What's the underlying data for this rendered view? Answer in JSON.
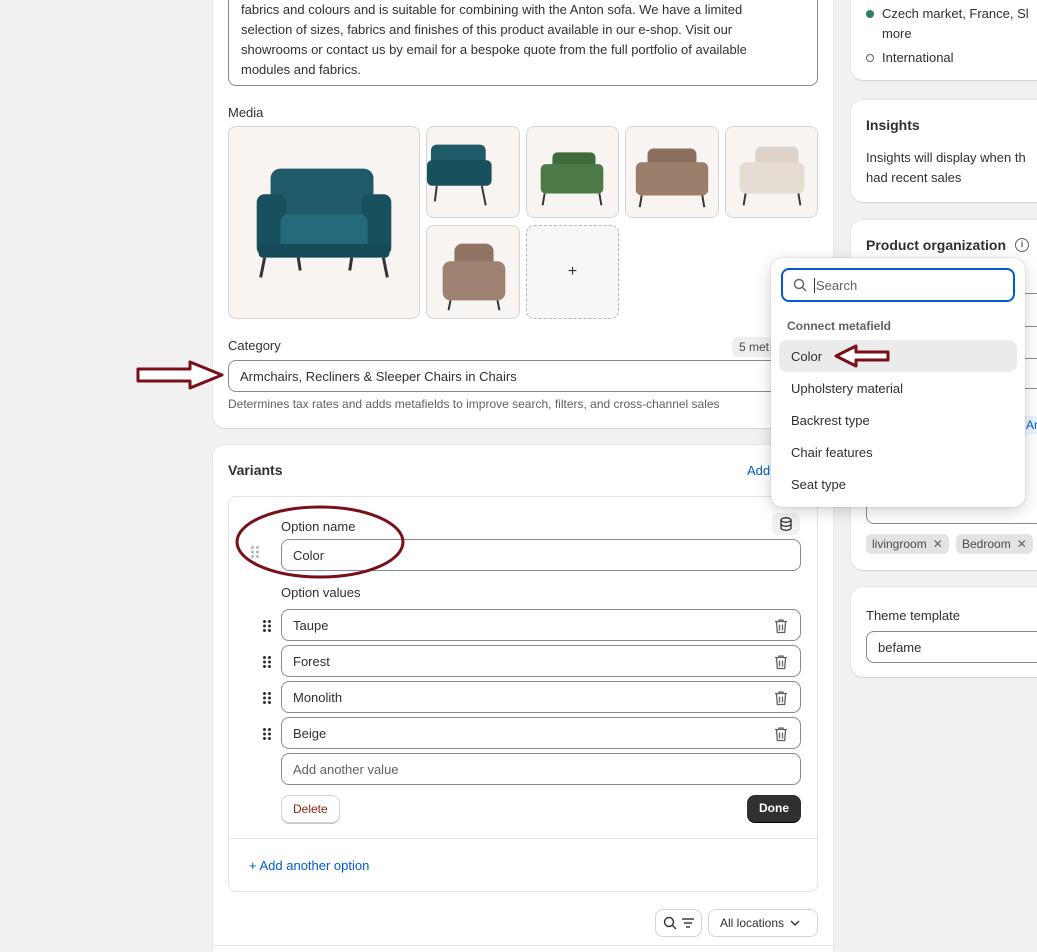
{
  "description": {
    "line1": "fabrics and colours and is suitable for combining with the Anton sofa. We have a limited",
    "line2": "selection of sizes, fabrics and finishes of this product available in our e-shop. Visit our",
    "line3": "showrooms or contact us by email for a bespoke quote from the full portfolio of available",
    "line4": "modules and fabrics."
  },
  "media": {
    "label": "Media",
    "add_symbol": "+"
  },
  "category": {
    "label": "Category",
    "badge": "5 met",
    "value": "Armchairs, Recliners & Sleeper Chairs in Chairs",
    "help": "Determines tax rates and adds metafields to improve search, filters, and cross-channel sales"
  },
  "variants": {
    "title": "Variants",
    "add_link": "Add",
    "option_name_label": "Option name",
    "option_name_value": "Color",
    "option_values_label": "Option values",
    "values": [
      "Taupe",
      "Forest",
      "Monolith",
      "Beige"
    ],
    "add_value_placeholder": "Add another value",
    "delete_label": "Delete",
    "done_label": "Done",
    "add_option_label": "+ Add another option",
    "locations_label": "All locations"
  },
  "markets": {
    "item1_line1": "Czech market, France, Sl",
    "item1_line2": "more",
    "item2": "International"
  },
  "insights": {
    "title": "Insights",
    "line1": "Insights will display when th",
    "line2": "had recent sales"
  },
  "organization": {
    "title": "Product organization",
    "tags": [
      "livingroom",
      "Bedroom"
    ],
    "partial_link": "Ar"
  },
  "theme": {
    "label": "Theme template",
    "value": "befame"
  },
  "dropdown": {
    "search_placeholder": "Search",
    "section_title": "Connect metafield",
    "items": [
      "Color",
      "Upholstery material",
      "Backrest type",
      "Chair features",
      "Seat type"
    ]
  },
  "colors": {
    "annotation": "#7a0f1a",
    "market_active": "#29845a",
    "link": "#005bd3",
    "done_bg": "#303030",
    "delete_text": "#8e1f0b"
  }
}
